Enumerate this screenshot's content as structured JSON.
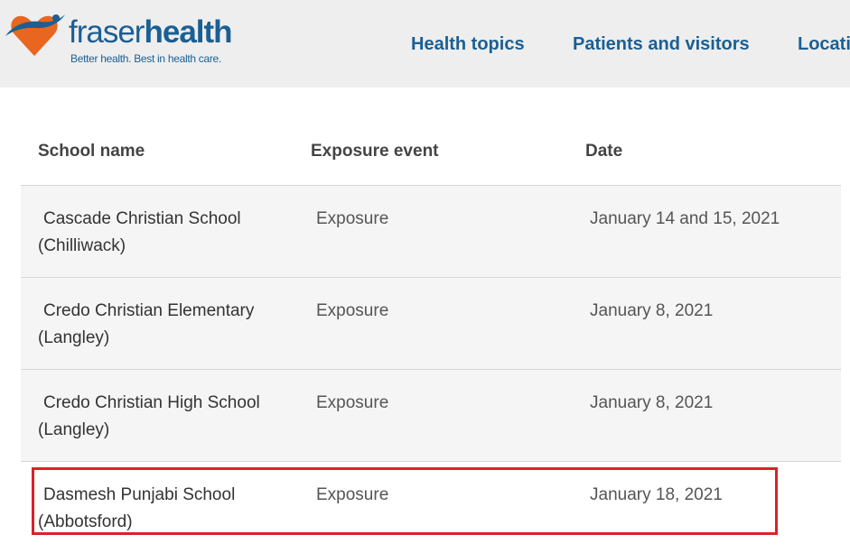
{
  "brand": {
    "name_regular": "fraser",
    "name_bold": "health",
    "tagline": "Better health. Best in health care.",
    "colors": {
      "primary": "#1b5f93",
      "accent": "#e8661f",
      "highlight": "#d9222a"
    }
  },
  "nav": {
    "items": [
      {
        "label": "Health topics"
      },
      {
        "label": "Patients and visitors"
      },
      {
        "label": "Locati"
      }
    ]
  },
  "table": {
    "headers": {
      "school": "School name",
      "event": "Exposure event",
      "date": "Date"
    },
    "rows": [
      {
        "school_line1": "Cascade Christian School",
        "school_line2": "(Chilliwack)",
        "event": "Exposure",
        "date": "January 14 and 15, 2021"
      },
      {
        "school_line1": "Credo Christian Elementary",
        "school_line2": "(Langley)",
        "event": "Exposure",
        "date": "January 8, 2021"
      },
      {
        "school_line1": "Credo Christian High School",
        "school_line2": "(Langley)",
        "event": "Exposure",
        "date": "January 8, 2021"
      },
      {
        "school_line1": "Dasmesh Punjabi School",
        "school_line2": "(Abbotsford)",
        "event": "Exposure",
        "date": "January 18, 2021"
      }
    ]
  }
}
